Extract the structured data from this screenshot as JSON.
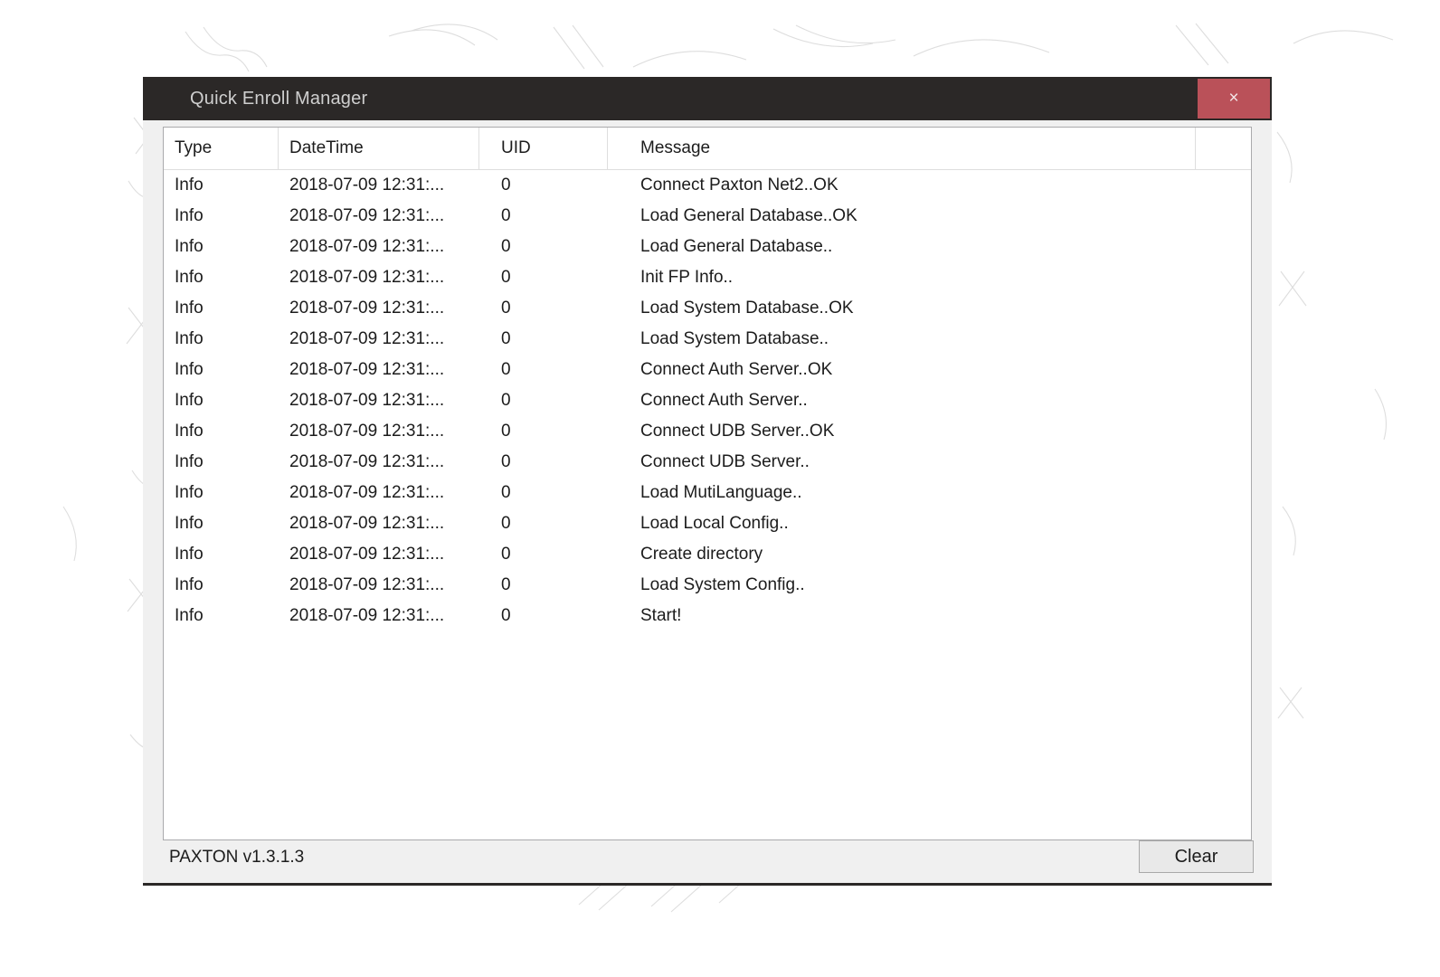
{
  "window": {
    "title": "Quick Enroll Manager",
    "close_label": "×",
    "accent_close_color": "#ba5159",
    "titlebar_color": "#2b2827",
    "body_color": "#f0f0f0"
  },
  "log_table": {
    "columns": [
      "Type",
      "DateTime",
      "UID",
      "Message"
    ],
    "rows": [
      {
        "type": "Info",
        "datetime": "2018-07-09 12:31:...",
        "uid": "0",
        "message": "Connect Paxton Net2..OK"
      },
      {
        "type": "Info",
        "datetime": "2018-07-09 12:31:...",
        "uid": "0",
        "message": "Load General Database..OK"
      },
      {
        "type": "Info",
        "datetime": "2018-07-09 12:31:...",
        "uid": "0",
        "message": "Load General Database.."
      },
      {
        "type": "Info",
        "datetime": "2018-07-09 12:31:...",
        "uid": "0",
        "message": "Init FP Info.."
      },
      {
        "type": "Info",
        "datetime": "2018-07-09 12:31:...",
        "uid": "0",
        "message": "Load System Database..OK"
      },
      {
        "type": "Info",
        "datetime": "2018-07-09 12:31:...",
        "uid": "0",
        "message": "Load System Database.."
      },
      {
        "type": "Info",
        "datetime": "2018-07-09 12:31:...",
        "uid": "0",
        "message": "Connect Auth Server..OK"
      },
      {
        "type": "Info",
        "datetime": "2018-07-09 12:31:...",
        "uid": "0",
        "message": "Connect Auth Server.."
      },
      {
        "type": "Info",
        "datetime": "2018-07-09 12:31:...",
        "uid": "0",
        "message": "Connect UDB Server..OK"
      },
      {
        "type": "Info",
        "datetime": "2018-07-09 12:31:...",
        "uid": "0",
        "message": "Connect UDB Server.."
      },
      {
        "type": "Info",
        "datetime": "2018-07-09 12:31:...",
        "uid": "0",
        "message": "Load MutiLanguage.."
      },
      {
        "type": "Info",
        "datetime": "2018-07-09 12:31:...",
        "uid": "0",
        "message": "Load Local Config.."
      },
      {
        "type": "Info",
        "datetime": "2018-07-09 12:31:...",
        "uid": "0",
        "message": "Create directory"
      },
      {
        "type": "Info",
        "datetime": "2018-07-09 12:31:...",
        "uid": "0",
        "message": "Load System Config.."
      },
      {
        "type": "Info",
        "datetime": "2018-07-09 12:31:...",
        "uid": "0",
        "message": "Start!"
      }
    ]
  },
  "statusbar": {
    "version": "PAXTON v1.3.1.3",
    "clear_label": "Clear"
  }
}
